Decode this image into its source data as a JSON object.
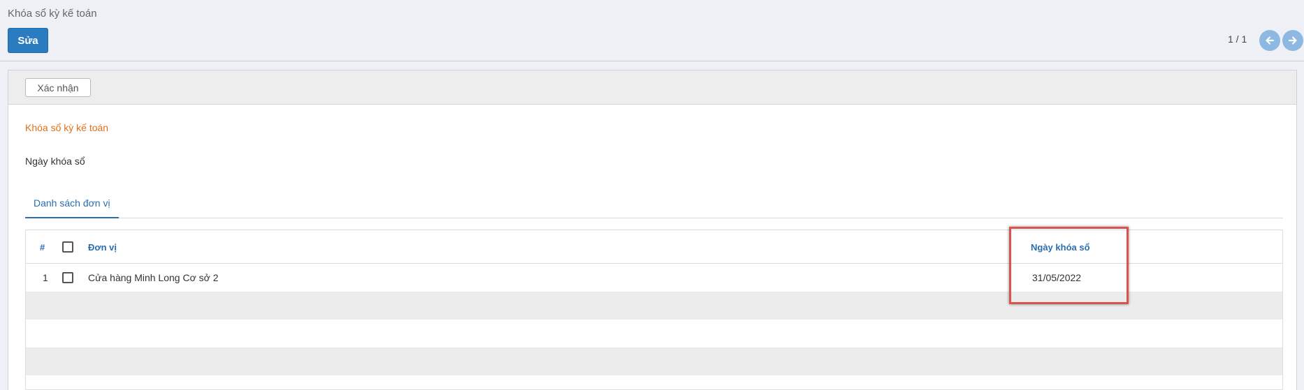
{
  "control_panel": {
    "breadcrumb": "Khóa sổ kỳ kế toán",
    "edit_label": "Sửa",
    "pager_value": "1 / 1"
  },
  "sheet": {
    "confirm_label": "Xác nhận",
    "form_title": "Khóa sổ kỳ kế toán",
    "field_label": "Ngày khóa sổ",
    "tab_label": "Danh sách đơn vị"
  },
  "table": {
    "headers": {
      "index": "#",
      "unit": "Đơn vị",
      "lock_date": "Ngày khóa sổ"
    },
    "rows": [
      {
        "index": "1",
        "unit": "Cửa hàng Minh Long Cơ sở 2",
        "lock_date": "31/05/2022"
      }
    ]
  },
  "colors": {
    "primary": "#2a7bbf",
    "accent_orange": "#e0701b",
    "link_blue": "#2a6eb0",
    "highlight_red": "#d9534f"
  },
  "icons": {
    "prev": "arrow-left-icon",
    "next": "arrow-right-icon"
  }
}
